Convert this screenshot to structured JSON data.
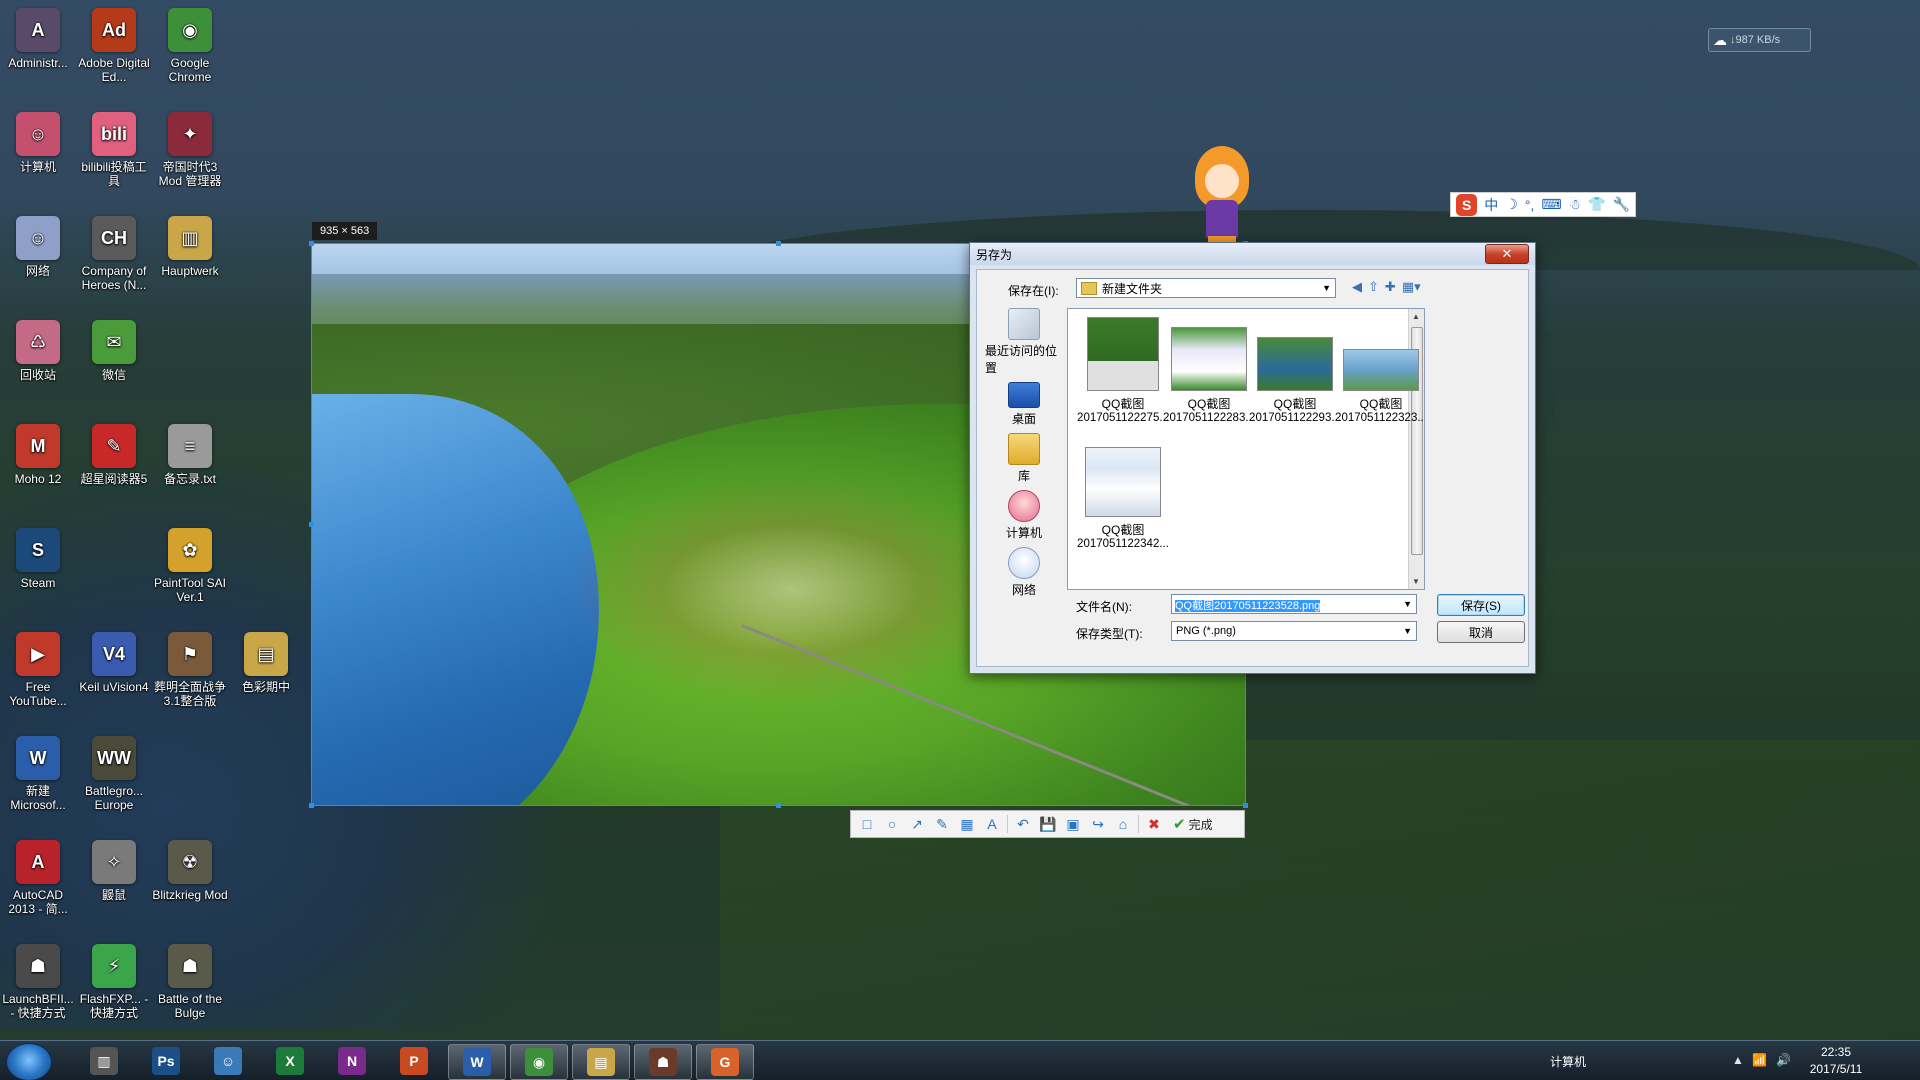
{
  "desktop": {
    "icons": [
      {
        "label": "Administr...",
        "glyph": "A",
        "color": "#5a4a6a"
      },
      {
        "label": "Adobe Digital Ed...",
        "glyph": "Ad",
        "color": "#b43a1a"
      },
      {
        "label": "Google Chrome",
        "glyph": "◉",
        "color": "#3d8f3a"
      },
      {
        "label": "计算机",
        "glyph": "☺",
        "color": "#c4506e"
      },
      {
        "label": "bilibili投稿工具",
        "glyph": "bili",
        "color": "#e0607e"
      },
      {
        "label": "帝国时代3 Mod 管理器",
        "glyph": "✦",
        "color": "#8a2a3a"
      },
      {
        "label": "网络",
        "glyph": "☺",
        "color": "#8ea0c8"
      },
      {
        "label": "Company of Heroes (N...",
        "glyph": "CH",
        "color": "#5a5a5a"
      },
      {
        "label": "Hauptwerk",
        "glyph": "▥",
        "color": "#c9a648"
      },
      {
        "label": "回收站",
        "glyph": "♺",
        "color": "#c46a86"
      },
      {
        "label": "微信",
        "glyph": "✉",
        "color": "#4a9c3a"
      },
      {
        "label": "Moho 12",
        "glyph": "M",
        "color": "#c0392b"
      },
      {
        "label": "超星阅读器5",
        "glyph": "✎",
        "color": "#c82828"
      },
      {
        "label": "备忘录.txt",
        "glyph": "≡",
        "color": "#9a9a9a"
      },
      {
        "label": "Steam",
        "glyph": "S",
        "color": "#1b4a7a"
      },
      {
        "label": "PaintTool SAI Ver.1",
        "glyph": "✿",
        "color": "#d4a12c"
      },
      {
        "label": "Free YouTube...",
        "glyph": "▶",
        "color": "#c0392b"
      },
      {
        "label": "Keil uVision4",
        "glyph": "V4",
        "color": "#3b5bb0"
      },
      {
        "label": "葬明全面战争3.1整合版",
        "glyph": "⚑",
        "color": "#7a5a3a"
      },
      {
        "label": "色彩期中",
        "glyph": "▤",
        "color": "#c9a648"
      },
      {
        "label": "新建 Microsof...",
        "glyph": "W",
        "color": "#2b5eaa"
      },
      {
        "label": "Battlegro... Europe",
        "glyph": "WW",
        "color": "#4a4a3a"
      },
      {
        "label": "AutoCAD 2013 - 简...",
        "glyph": "A",
        "color": "#b8232b"
      },
      {
        "label": "鼹鼠",
        "glyph": "✧",
        "color": "#7a7a7a"
      },
      {
        "label": "Blitzkrieg Mod",
        "glyph": "☢",
        "color": "#5a5a4a"
      },
      {
        "label": "LaunchBFII... - 快捷方式",
        "glyph": "☗",
        "color": "#4a4a4a"
      },
      {
        "label": "FlashFXP... - 快捷方式",
        "glyph": "⚡",
        "color": "#3aa54a"
      },
      {
        "label": "Battle of the Bulge",
        "glyph": "☗",
        "color": "#5a5a4a"
      }
    ]
  },
  "capture": {
    "size_label": "935 × 563",
    "toolbar": {
      "tools": [
        "rect-tool-icon",
        "ellipse-tool-icon",
        "arrow-tool-icon",
        "pen-tool-icon",
        "mosaic-tool-icon",
        "text-tool-icon",
        "undo-icon",
        "save-icon",
        "copy-icon",
        "share-icon",
        "pin-icon"
      ],
      "tool_glyphs": [
        "□",
        "○",
        "↗",
        "✎",
        "▦",
        "A",
        "↶",
        "💾",
        "▣",
        "↪",
        "⌂"
      ],
      "cancel_glyph": "✖",
      "done_glyph": "✔",
      "done_label": "完成"
    }
  },
  "ime": {
    "logo": "S",
    "items": [
      "中",
      "☽",
      "°,",
      "⌨",
      "☃",
      "👕",
      "🔧"
    ]
  },
  "netspeed": {
    "icon": "☁",
    "text": "↓987 KB/s"
  },
  "dialog": {
    "title": "另存为",
    "close_label": "✕",
    "save_in_label": "保存在(I):",
    "save_in_value": "新建文件夹",
    "nav": [
      "◀",
      "⇧",
      "✚",
      "▦▾"
    ],
    "places": [
      {
        "label": "最近访问的位置",
        "kind": "recent"
      },
      {
        "label": "桌面",
        "kind": "desktop"
      },
      {
        "label": "库",
        "kind": "lib"
      },
      {
        "label": "计算机",
        "kind": "comp"
      },
      {
        "label": "网络",
        "kind": "net"
      }
    ],
    "files": [
      {
        "line1": "QQ截图",
        "line2": "2017051122275..."
      },
      {
        "line1": "QQ截图",
        "line2": "2017051122283..."
      },
      {
        "line1": "QQ截图",
        "line2": "2017051122293..."
      },
      {
        "line1": "QQ截图",
        "line2": "2017051122323..."
      },
      {
        "line1": "QQ截图",
        "line2": "2017051122342..."
      }
    ],
    "filename_label": "文件名(N):",
    "filename_value": "QQ截图20170511223528.png",
    "filetype_label": "保存类型(T):",
    "filetype_value": "PNG (*.png)",
    "save_button": "保存(S)",
    "cancel_button": "取消"
  },
  "taskbar": {
    "apps": [
      {
        "name": "piano-app",
        "glyph": "▥",
        "color": "#555",
        "active": false
      },
      {
        "name": "photoshop-app",
        "glyph": "Ps",
        "color": "#1b4f86",
        "active": false
      },
      {
        "name": "qq-app",
        "glyph": "☺",
        "color": "#3a7ab8",
        "active": false
      },
      {
        "name": "excel-app",
        "glyph": "X",
        "color": "#1e7a3a",
        "active": false
      },
      {
        "name": "onenote-app",
        "glyph": "N",
        "color": "#7a2a8a",
        "active": false
      },
      {
        "name": "powerpoint-app",
        "glyph": "P",
        "color": "#c84a22",
        "active": false
      },
      {
        "name": "word-app",
        "glyph": "W",
        "color": "#2b5eaa",
        "active": true
      },
      {
        "name": "chrome-app",
        "glyph": "◉",
        "color": "#3d8f3a",
        "active": true
      },
      {
        "name": "explorer-app",
        "glyph": "▤",
        "color": "#c9a648",
        "active": true
      },
      {
        "name": "game-app",
        "glyph": "☗",
        "color": "#6a3a2a",
        "active": true
      },
      {
        "name": "foxit-app",
        "glyph": "G",
        "color": "#d8632a",
        "active": true
      }
    ],
    "tray_computer": "计算机",
    "tray_symbols": [
      "▲",
      "📶",
      "🔊"
    ],
    "time": "22:35",
    "date": "2017/5/11"
  }
}
